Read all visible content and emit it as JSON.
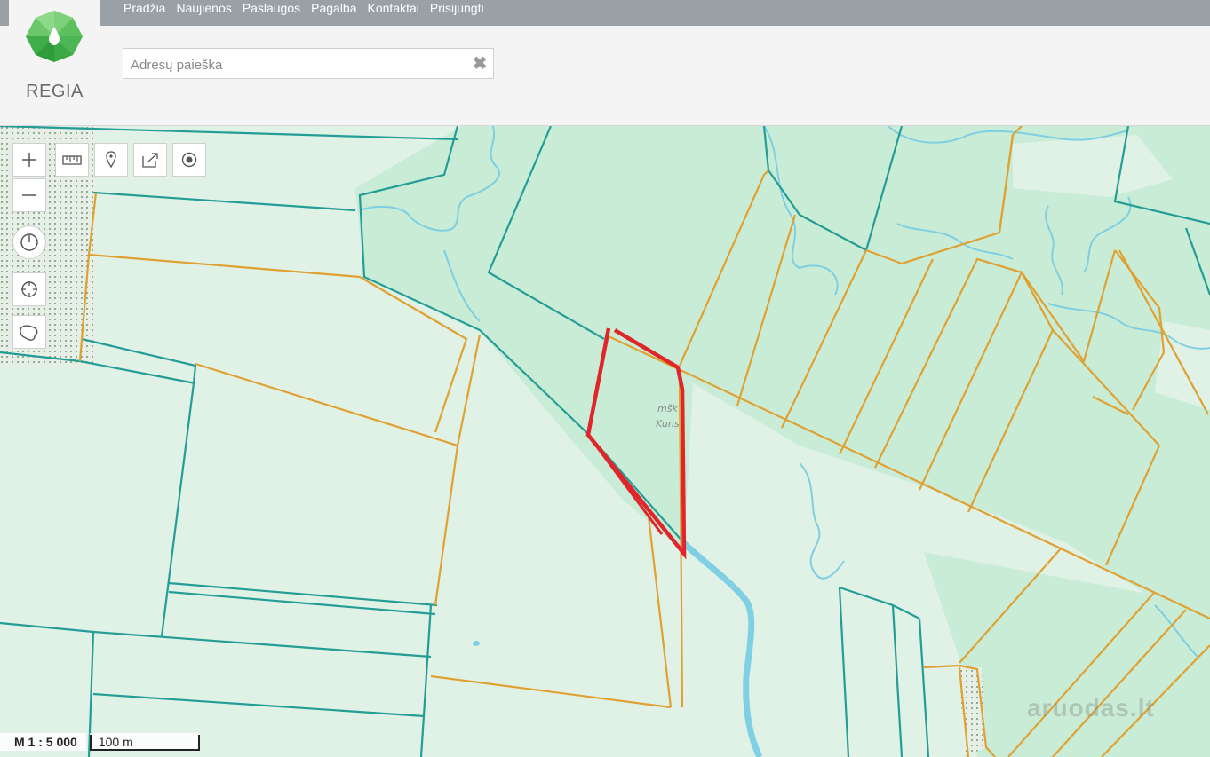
{
  "header": {
    "nav": [
      "Pradžia",
      "Naujienos",
      "Paslaugos",
      "Pagalba",
      "Kontaktai",
      "Prisijungti"
    ],
    "logo_text": "REGIA"
  },
  "search": {
    "placeholder": "Adresų paieška",
    "value": "",
    "clear_glyph": "✖"
  },
  "map": {
    "labels": [
      "mšk",
      "Kuns"
    ],
    "scale": "M 1 : 5 000",
    "scale_distance": "100 m",
    "watermark": "aruodas.lt",
    "colors": {
      "background": "#e0f2e6",
      "forest": "#c9ecd7",
      "parcel_orange": "#e0a133",
      "parcel_teal": "#239d96",
      "selected_parcel": "#e0262a",
      "river": "#7fd0e4"
    }
  },
  "tools": {
    "zoom_in": "+",
    "zoom_out": "—"
  }
}
